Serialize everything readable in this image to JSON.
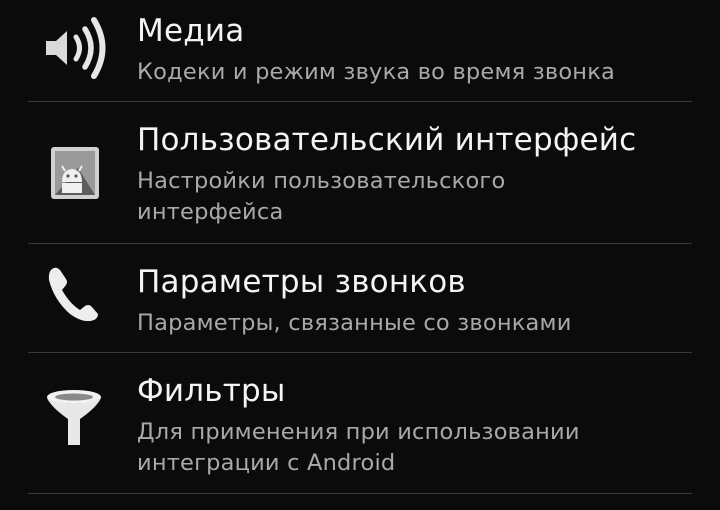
{
  "settings": {
    "items": [
      {
        "title": "Медиа",
        "subtitle": "Кодеки и режим звука во время звонка",
        "icon": "speaker-icon"
      },
      {
        "title": "Пользовательский интерфейс",
        "subtitle": "Настройки пользовательского интерфейса",
        "icon": "android-app-icon"
      },
      {
        "title": "Параметры звонков",
        "subtitle": "Параметры, связанные со звонками",
        "icon": "phone-icon"
      },
      {
        "title": "Фильтры",
        "subtitle": "Для применения при использовании интеграции с Android",
        "icon": "filter-icon"
      }
    ]
  }
}
